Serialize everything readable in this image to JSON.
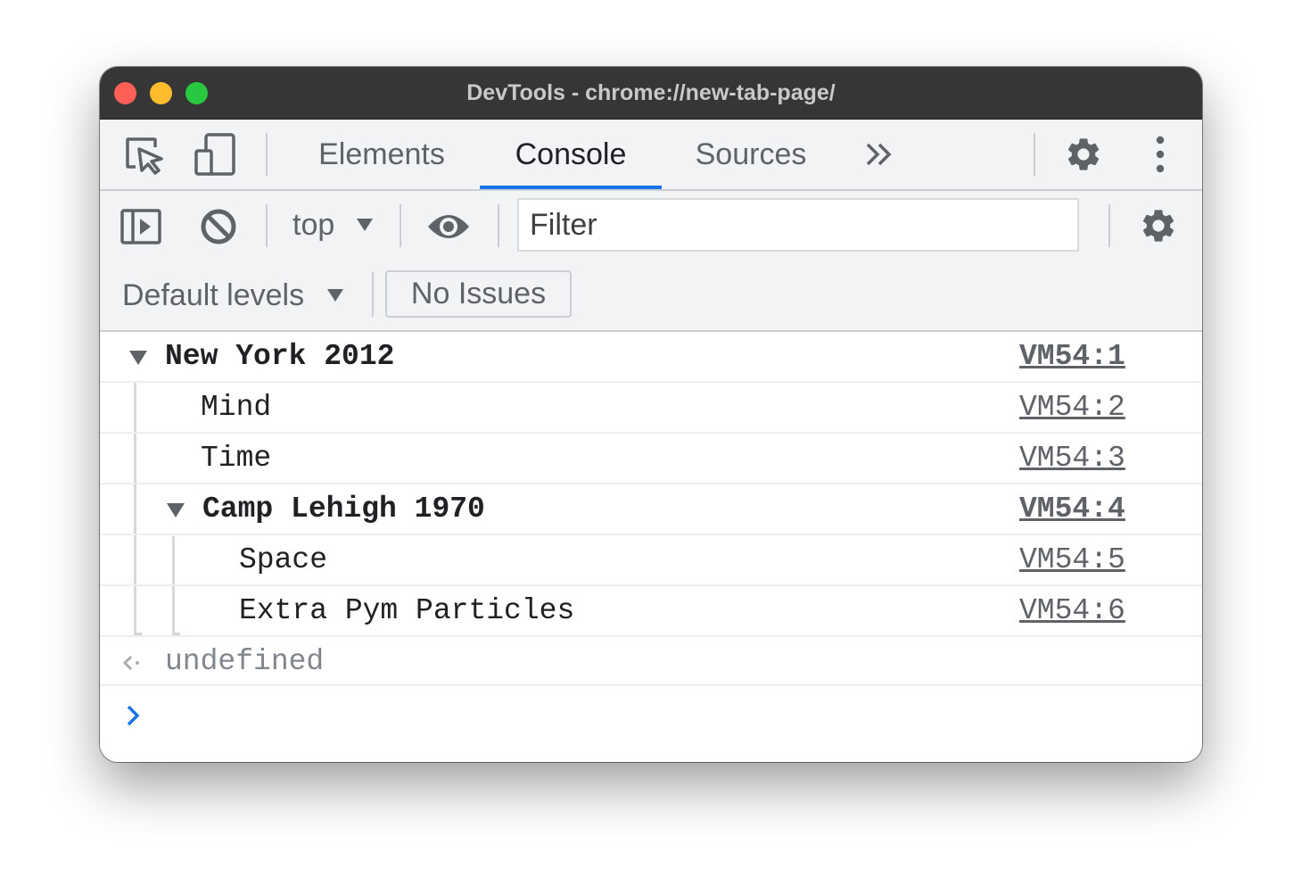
{
  "window": {
    "title": "DevTools - chrome://new-tab-page/"
  },
  "tabs": [
    {
      "label": "Elements"
    },
    {
      "label": "Console"
    },
    {
      "label": "Sources"
    }
  ],
  "toolbar": {
    "context": "top",
    "filter_placeholder": "Filter",
    "levels": "Default levels",
    "issues": "No Issues"
  },
  "console": {
    "rows": [
      {
        "text": "New York 2012",
        "source": "VM54:1",
        "group": true
      },
      {
        "text": "Mind",
        "source": "VM54:2"
      },
      {
        "text": "Time",
        "source": "VM54:3"
      },
      {
        "text": "Camp Lehigh 1970",
        "source": "VM54:4",
        "group": true
      },
      {
        "text": "Space",
        "source": "VM54:5"
      },
      {
        "text": "Extra Pym Particles",
        "source": "VM54:6"
      }
    ],
    "result": "undefined"
  },
  "colors": {
    "accent": "#1a73e8",
    "toolbar_bg": "#f1f3f4",
    "titlebar_bg": "#363636"
  },
  "icons": [
    "inspect-element-icon",
    "device-toolbar-icon",
    "more-tabs-icon",
    "settings-icon",
    "more-options-icon",
    "sidebar-toggle-icon",
    "clear-console-icon",
    "dropdown-caret-icon",
    "eye-icon",
    "console-settings-icon",
    "expand-triangle-icon",
    "result-arrow-icon",
    "prompt-icon"
  ]
}
